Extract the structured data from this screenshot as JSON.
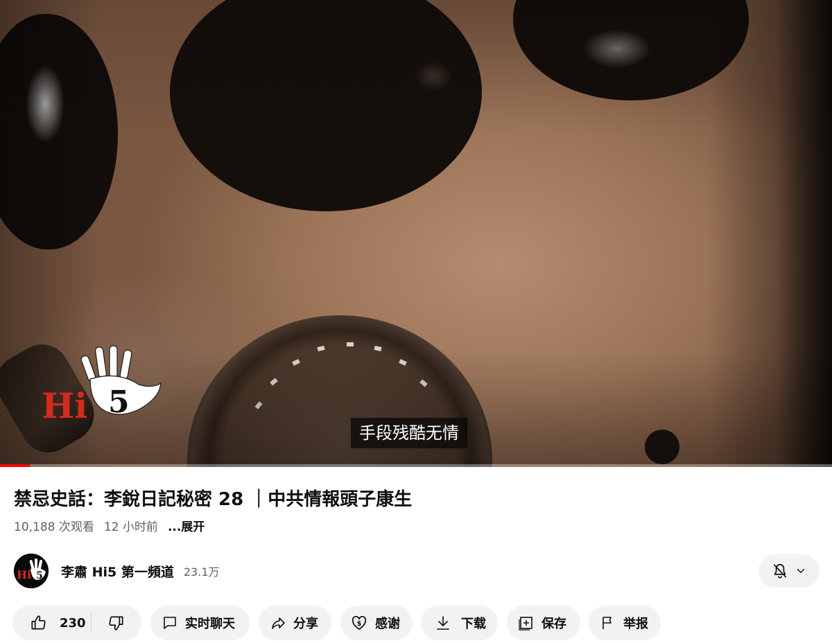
{
  "player": {
    "subtitle": "手段残酷无情",
    "watermark_text": "Hi5",
    "progress_fraction": 0.036
  },
  "video": {
    "title": "禁忌史話：李銳日記秘密 28 ｜中共情報頭子康生",
    "views": "10,188 次观看",
    "published": "12 小时前",
    "more_label": "...展开"
  },
  "channel": {
    "name": "李肅 Hi5 第一頻道",
    "subscribers": "23.1万",
    "avatar_text": "Hi5"
  },
  "actions": {
    "like_count": "230",
    "chat_label": "实时聊天",
    "share_label": "分享",
    "thanks_label": "感谢",
    "download_label": "下载",
    "save_label": "保存",
    "report_label": "举报"
  },
  "icons": {
    "notification": "bell-off-icon",
    "dropdown": "chevron-down-icon",
    "like": "thumbs-up-icon",
    "dislike": "thumbs-down-icon",
    "chat": "chat-icon",
    "share": "share-arrow-icon",
    "thanks": "heart-dollar-icon",
    "download": "download-icon",
    "save": "playlist-add-icon",
    "report": "flag-icon"
  },
  "colors": {
    "progress": "#ff0000",
    "logo_red": "#d42a1f",
    "pill_bg": "#f2f2f2",
    "secondary_text": "#606060"
  }
}
